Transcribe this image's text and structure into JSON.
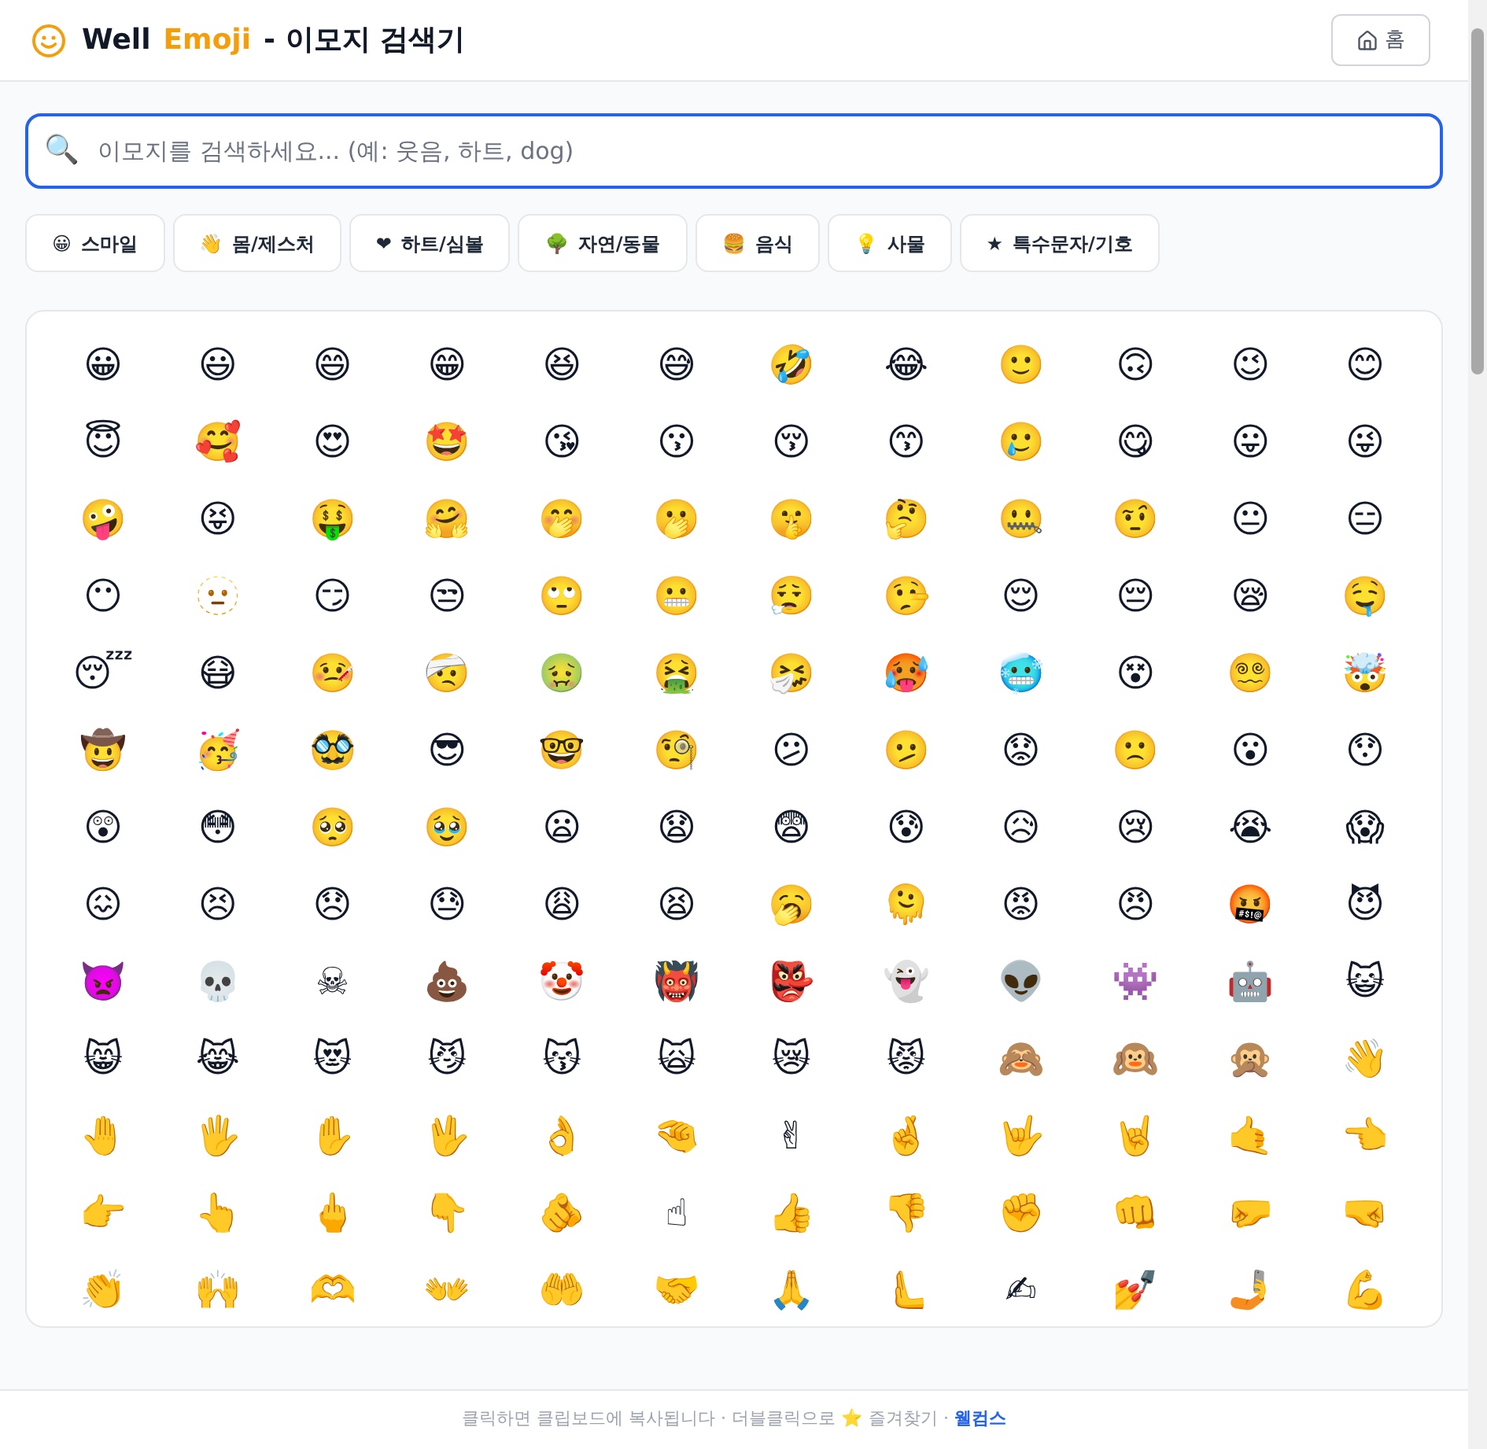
{
  "header": {
    "logo_parts": [
      {
        "text": "Well",
        "kind": "dark"
      },
      {
        "text": "Emoji",
        "kind": "accent"
      },
      {
        "text": "- 이모지 검색기",
        "kind": "dark"
      }
    ],
    "home_button": "홈"
  },
  "search": {
    "icon": "🔍",
    "placeholder": "이모지를 검색하세요... (예: 웃음, 하트, dog)"
  },
  "categories": [
    {
      "icon": "😀",
      "label": "스마일"
    },
    {
      "icon": "👋",
      "label": "몸/제스처"
    },
    {
      "icon": "❤",
      "label": "하트/심볼"
    },
    {
      "icon": "🌳",
      "label": "자연/동물"
    },
    {
      "icon": "🍔",
      "label": "음식"
    },
    {
      "icon": "💡",
      "label": "사물"
    },
    {
      "icon": "★",
      "label": "특수문자/기호"
    }
  ],
  "emojis": [
    "😀",
    "😃",
    "😄",
    "😁",
    "😆",
    "😅",
    "🤣",
    "😂",
    "🙂",
    "🙃",
    "😉",
    "😊",
    "😇",
    "🥰",
    "😍",
    "🤩",
    "😘",
    "😗",
    "😚",
    "😙",
    "🥲",
    "😋",
    "😛",
    "😜",
    "🤪",
    "😝",
    "🤑",
    "🤗",
    "🤭",
    "🫢",
    "🤫",
    "🤔",
    "🤐",
    "🤨",
    "😐",
    "😑",
    "😶",
    "🫥",
    "😏",
    "😒",
    "🙄",
    "😬",
    "😮‍💨",
    "🤥",
    "😌",
    "😔",
    "😪",
    "🤤",
    "😴",
    "😷",
    "🤒",
    "🤕",
    "🤢",
    "🤮",
    "🤧",
    "🥵",
    "🥶",
    "😵",
    "😵‍💫",
    "🤯",
    "🤠",
    "🥳",
    "🥸",
    "😎",
    "🤓",
    "🧐",
    "😕",
    "🫤",
    "😟",
    "🙁",
    "😮",
    "😯",
    "😲",
    "😳",
    "🥺",
    "🥹",
    "😦",
    "😧",
    "😨",
    "😰",
    "😥",
    "😢",
    "😭",
    "😱",
    "😖",
    "😣",
    "😞",
    "😓",
    "😩",
    "😫",
    "🥱",
    "🫠",
    "😡",
    "😠",
    "🤬",
    "😈",
    "👿",
    "💀",
    "☠",
    "💩",
    "🤡",
    "👹",
    "👺",
    "👻",
    "👽",
    "👾",
    "🤖",
    "😺",
    "😸",
    "😹",
    "😻",
    "😼",
    "😽",
    "🙀",
    "😿",
    "😾",
    "🙈",
    "🙉",
    "🙊",
    "👋",
    "🤚",
    "🖐",
    "✋",
    "🖖",
    "👌",
    "🤏",
    "✌",
    "🤞",
    "🤟",
    "🤘",
    "🤙",
    "👈",
    "👉",
    "👆",
    "🖕",
    "👇",
    "🫵",
    "☝",
    "👍",
    "👎",
    "✊",
    "👊",
    "🤛",
    "🤜",
    "👏",
    "🙌",
    "🫶",
    "👐",
    "🤲",
    "🤝",
    "🙏",
    "🫷",
    "✍",
    "💅",
    "🤳",
    "💪"
  ],
  "footer": {
    "text": "클릭하면 클립보드에 복사됩니다 · 더블클릭으로 ⭐ 즐겨찾기 · ",
    "link": "웰컴스"
  }
}
